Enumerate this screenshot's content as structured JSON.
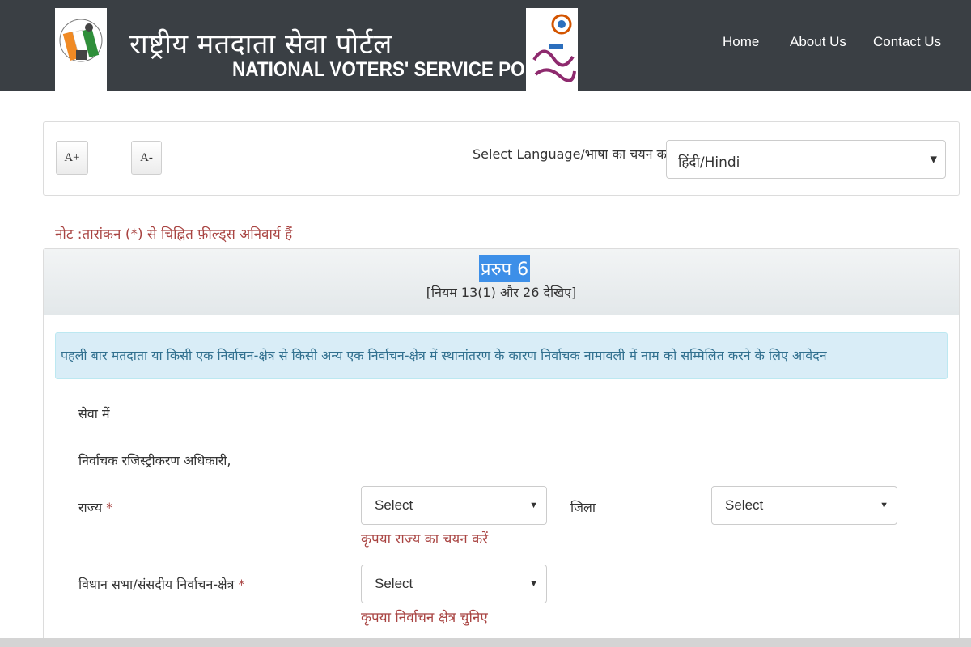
{
  "header": {
    "title_hindi": "राष्ट्रीय मतदाता सेवा पोर्टल",
    "title_english": "NATIONAL VOTERS' SERVICE PORTAL",
    "nav": {
      "home": "Home",
      "about": "About Us",
      "contact": "Contact Us"
    },
    "background_color": "#3a3f44"
  },
  "toolbar": {
    "font_increase": "A+",
    "font_decrease": "A-",
    "language_label": "Select Language/भाषा का चयन करें",
    "language_selected": "हिंदी/Hindi"
  },
  "note": "नोट :तारांकन (*) से चिह्नित फ़ील्ड्स अनिवार्य हैं",
  "form": {
    "title": "प्ररुप 6",
    "rule": "[नियम 13(1) और 26 देखिए]",
    "info": "पहली बार मतदाता या किसी एक निर्वाचन-क्षेत्र से किसी अन्य एक निर्वाचन-क्षेत्र में स्थानांतरण के कारण निर्वाचक नामावली में नाम को सम्मिलित करने के लिए आवेदन",
    "addressee_line1": "सेवा में",
    "addressee_line2": "निर्वाचक रजिस्ट्रीकरण अधिकारी,",
    "state_label": "राज्य",
    "required_mark": "*",
    "state_value": "Select",
    "state_error": "कृपया राज्य का चयन करें",
    "district_label": "जिला",
    "district_value": "Select",
    "constituency_label": "विधान सभा/संसदीय निर्वाचन-क्षेत्र",
    "constituency_value": "Select",
    "constituency_error": "कृपया निर्वाचन क्षेत्र चुनिए"
  },
  "colors": {
    "error_red": "#a94442",
    "info_bg": "#d9edf7",
    "selection_blue": "#3d8fe8"
  }
}
